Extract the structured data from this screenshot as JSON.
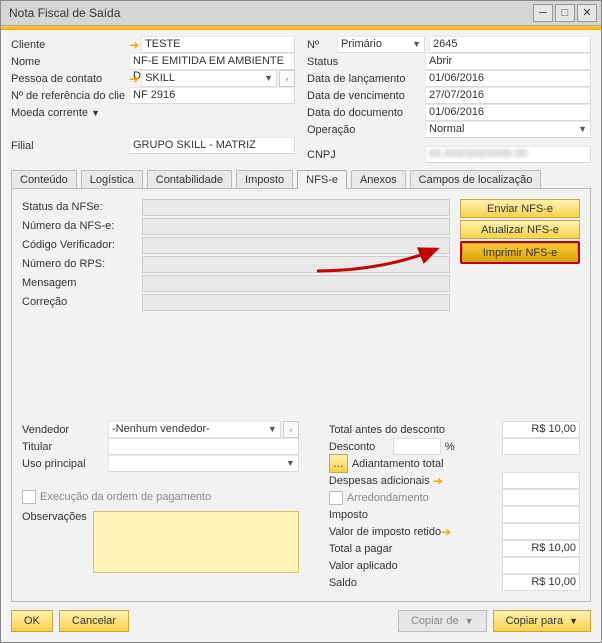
{
  "window": {
    "title": "Nota Fiscal de Saída"
  },
  "titlebar_icons": {
    "min": "minimize-icon",
    "max": "maximize-icon",
    "close": "close-icon"
  },
  "left": {
    "cliente_lbl": "Cliente",
    "cliente_val": "TESTE",
    "nome_lbl": "Nome",
    "nome_val": "NF-E EMITIDA EM AMBIENTE D",
    "pessoa_lbl": "Pessoa de contato",
    "pessoa_val": "SKILL",
    "ref_lbl": "Nº de referência do clie",
    "ref_val": "NF 2916",
    "moeda_lbl": "Moeda corrente",
    "filial_lbl": "Filial",
    "filial_val": "GRUPO SKILL - MATRIZ"
  },
  "right": {
    "no_lbl": "Nº",
    "no_type": "Primário",
    "no_val": "2645",
    "status_lbl": "Status",
    "status_val": "Abrir",
    "lanc_lbl": "Data de lançamento",
    "lanc_val": "01/06/2016",
    "venc_lbl": "Data de vencimento",
    "venc_val": "27/07/2016",
    "doc_lbl": "Data do documento",
    "doc_val": "01/06/2016",
    "oper_lbl": "Operação",
    "oper_val": "Normal",
    "cnpj_lbl": "CNPJ",
    "cnpj_val": "99.999/999/9999-99"
  },
  "tabs": {
    "conteudo": "Conteúdo",
    "logistica": "Logística",
    "contabilidade": "Contabilidade",
    "imposto": "Imposto",
    "nfse": "NFS-e",
    "anexos": "Anexos",
    "campos": "Campos de localização"
  },
  "nfse": {
    "status_lbl": "Status da NFSe:",
    "numero_lbl": "Número da NFS-e:",
    "codver_lbl": "Código Verificador:",
    "rps_lbl": "Número do RPS:",
    "msg_lbl": "Mensagem",
    "corr_lbl": "Correção",
    "btn_enviar": "Enviar NFS-e",
    "btn_atualizar": "Atualizar NFS-e",
    "btn_imprimir": "Imprimir NFS-e"
  },
  "bottom_left": {
    "vendedor_lbl": "Vendedor",
    "vendedor_val": "-Nenhum vendedor-",
    "titular_lbl": "Titular",
    "uso_lbl": "Uso principal",
    "exec_lbl": "Execução da ordem de pagamento",
    "obs_lbl": "Observações"
  },
  "totals": {
    "total_antes_lbl": "Total antes do desconto",
    "total_antes_val": "R$ 10,00",
    "desconto_lbl": "Desconto",
    "desconto_pct_suffix": "%",
    "adiant_lbl": "Adiantamento total",
    "desp_lbl": "Despesas adicionais",
    "arred_lbl": "Arredondamento",
    "imposto_lbl": "Imposto",
    "valret_lbl": "Valor de imposto retido",
    "total_pagar_lbl": "Total a pagar",
    "total_pagar_val": "R$ 10,00",
    "valor_apl_lbl": "Valor aplicado",
    "saldo_lbl": "Saldo",
    "saldo_val": "R$ 10,00"
  },
  "footer": {
    "ok": "OK",
    "cancelar": "Cancelar",
    "copiar_de": "Copiar de",
    "copiar_para": "Copiar para"
  }
}
